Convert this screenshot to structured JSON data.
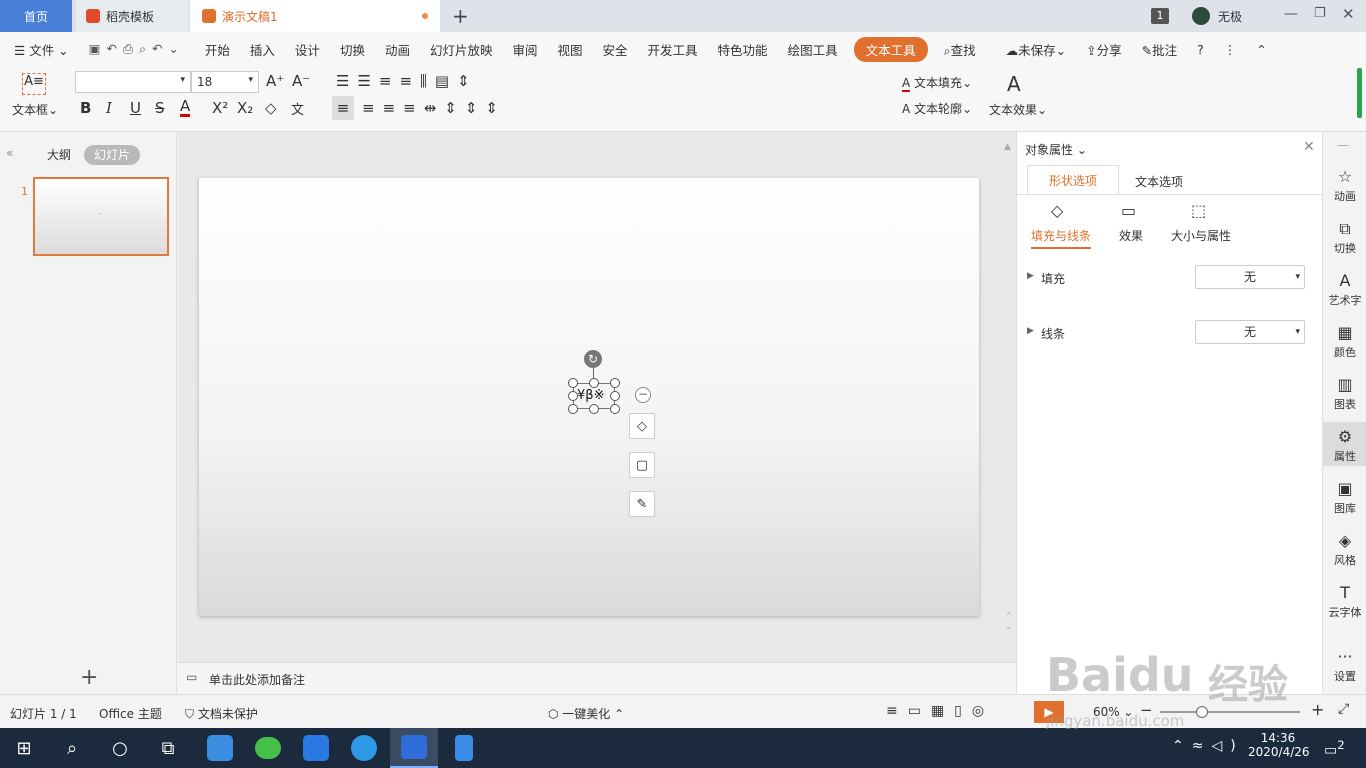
{
  "tabs": {
    "home": "首页",
    "templates": "稻壳模板",
    "doc": "演示文稿1"
  },
  "titlebar": {
    "badge": "1",
    "user": "无极"
  },
  "menu": {
    "file": "文件",
    "items": [
      "开始",
      "插入",
      "设计",
      "切换",
      "动画",
      "幻灯片放映",
      "审阅",
      "视图",
      "安全",
      "开发工具",
      "特色功能",
      "绘图工具"
    ],
    "active": "文本工具",
    "search": "查找",
    "unsaved": "未保存",
    "share": "分享",
    "comment": "批注"
  },
  "ribbon": {
    "textbox": "文本框",
    "font_size": "18",
    "text_fill": "文本填充",
    "text_outline": "文本轮廓",
    "text_effect": "文本效果",
    "art_letter": "A"
  },
  "leftpanel": {
    "outline": "大纲",
    "slides": "幻灯片",
    "slide_number": "1",
    "thumb_text": "-"
  },
  "slide": {
    "selected_text": "¥β※"
  },
  "notes": {
    "placeholder": "单击此处添加备注"
  },
  "rightpanel": {
    "title": "对象属性",
    "tabs": [
      "形状选项",
      "文本选项"
    ],
    "subtabs": [
      "填充与线条",
      "效果",
      "大小与属性"
    ],
    "fill_label": "填充",
    "fill_value": "无",
    "line_label": "线条",
    "line_value": "无"
  },
  "sidebar": [
    "动画",
    "切换",
    "艺术字",
    "颜色",
    "图表",
    "属性",
    "图库",
    "风格",
    "云字体",
    "设置"
  ],
  "status": {
    "slide_info": "幻灯片 1 / 1",
    "theme": "Office 主题",
    "protect": "文档未保护",
    "beautify": "一键美化",
    "zoom": "60%"
  },
  "taskbar": {
    "time": "14:36",
    "date": "2020/4/26",
    "notif": "2"
  },
  "watermark": {
    "brand": "Baidu",
    "cn": "经验",
    "url": "jingyan.baidu.com"
  },
  "colors": {
    "accent": "#e0702e",
    "home_tab": "#4a7fd8",
    "taskbar": "#1c2a3e"
  }
}
